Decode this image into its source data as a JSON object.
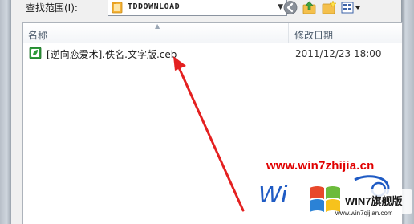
{
  "toolbar": {
    "look_in_label": "查找范围(I):",
    "look_in_value": "TDDOWNLOAD",
    "buttons": [
      "back-icon",
      "up-folder-icon",
      "new-folder-icon",
      "views-menu-icon"
    ]
  },
  "list": {
    "columns": {
      "name": "名称",
      "date_modified": "修改日期"
    },
    "files": [
      {
        "name": "[逆向恋爱术].佚名.文字版.ceb",
        "date_modified": "2011/12/23 18:00",
        "icon": "ceb-file-icon"
      }
    ]
  },
  "watermark": {
    "url": "www.win7zhijia.cn",
    "brand": "WIN7旗舰版",
    "domain": "www.win7qijian.com"
  },
  "colors": {
    "annotation_arrow": "#e42020",
    "watermark_url": "#e00000",
    "logo_blue": "#1f5bc4"
  }
}
